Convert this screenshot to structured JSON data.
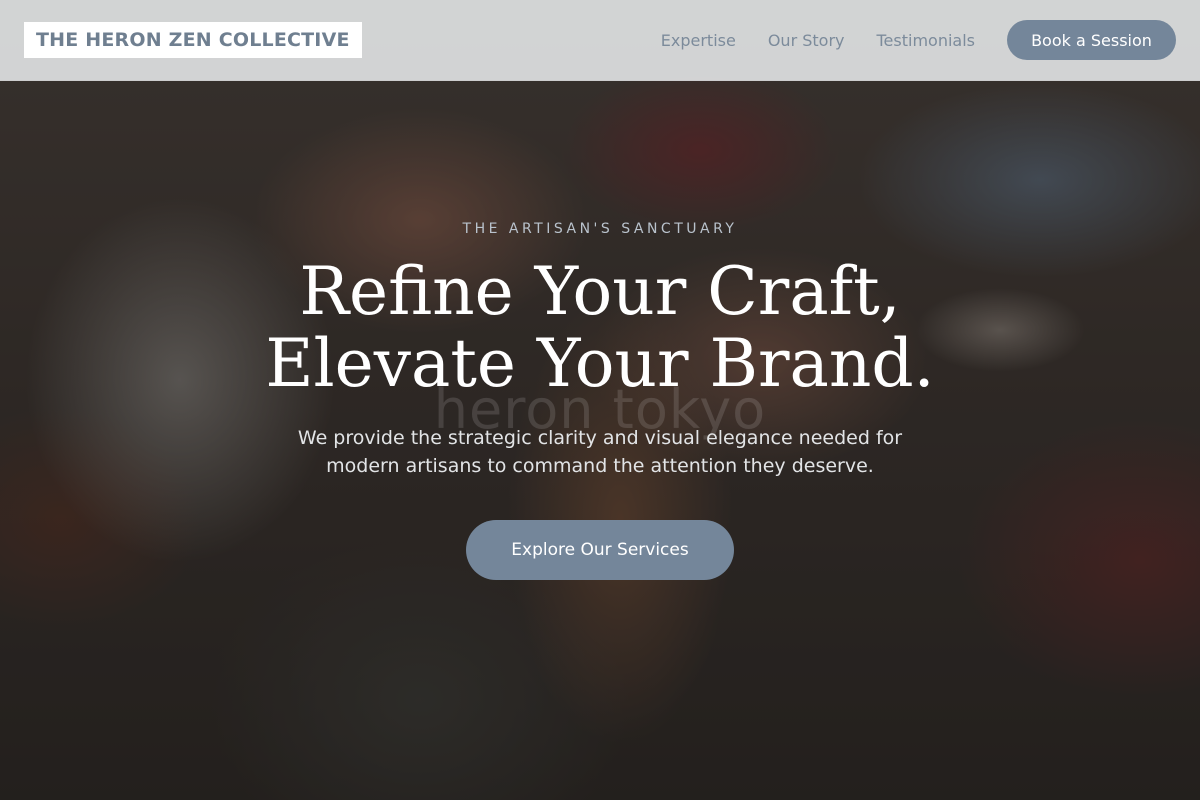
{
  "navbar": {
    "brand": "THE HERON ZEN COLLECTIVE",
    "links": [
      "Expertise",
      "Our Story",
      "Testimonials"
    ],
    "cta_label": "Book a Session"
  },
  "hero": {
    "eyebrow": "THE ARTISAN'S SANCTUARY",
    "headline_lines": [
      "Refine Your Craft,",
      "Elevate Your Brand."
    ],
    "subtext_lines": [
      "We provide the strategic clarity and visual elegance needed for",
      "modern artisans to command the attention they deserve."
    ],
    "cta_label": "Explore Our Services",
    "watermark": "heron tokyo"
  },
  "colors": {
    "accent": "#74869a",
    "nav_text": "#7c8b9b",
    "brand_text": "#6f7f90",
    "headline": "#ffffff"
  }
}
